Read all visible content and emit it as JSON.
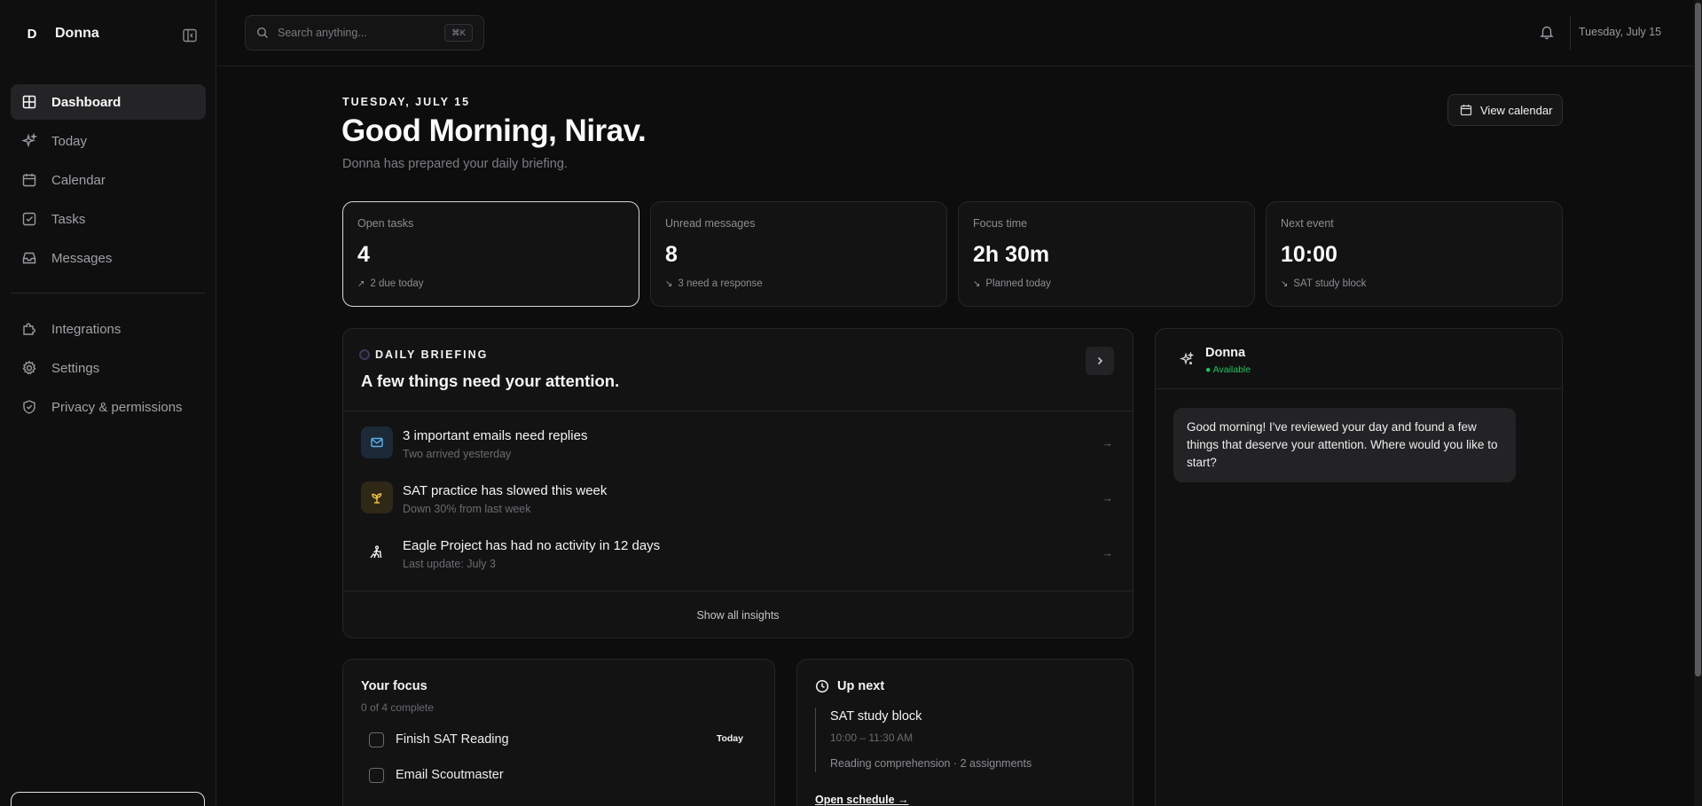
{
  "sidebar": {
    "logo_letter": "D",
    "brand_name": "Donna",
    "items": [
      {
        "label": "Dashboard",
        "icon": "grid-icon"
      },
      {
        "label": "Today",
        "icon": "sparkle-icon"
      },
      {
        "label": "Calendar",
        "icon": "calendar-icon"
      },
      {
        "label": "Tasks",
        "icon": "check-square-icon"
      },
      {
        "label": "Messages",
        "icon": "inbox-icon"
      },
      {
        "label": "Integrations",
        "icon": "puzzle-icon"
      },
      {
        "label": "Settings",
        "icon": "gear-icon"
      },
      {
        "label": "Privacy & permissions",
        "icon": "shield-icon"
      }
    ],
    "active_item": "Dashboard"
  },
  "topbar": {
    "search_placeholder": "Search anything...",
    "shortcut": "⌘K",
    "date": "Tuesday, July 15"
  },
  "header": {
    "date_kicker": "TUESDAY, JULY 15",
    "title": "Good Morning, Nirav.",
    "subtitle": "Donna has prepared your daily briefing.",
    "view_calendar_label": "View calendar"
  },
  "stats": [
    {
      "label": "Open tasks",
      "value": "4",
      "note": "2 due today",
      "arrow": "↗"
    },
    {
      "label": "Unread messages",
      "value": "8",
      "note": "3 need a response",
      "arrow": "↘"
    },
    {
      "label": "Focus time",
      "value": "2h 30m",
      "note": "Planned today",
      "arrow": "↘"
    },
    {
      "label": "Next event",
      "value": "10:00",
      "note": "SAT study block",
      "arrow": "↘"
    }
  ],
  "briefing": {
    "kicker": "DAILY BRIEFING",
    "title": "A few things need your attention.",
    "insights": [
      {
        "title": "3 important emails need replies",
        "subtitle": "Two arrived yesterday",
        "icon": "mail-icon",
        "color": "#5eb0ef"
      },
      {
        "title": "SAT practice has slowed this week",
        "subtitle": "Down 30% from last week",
        "icon": "sprout-icon",
        "color": "#f5c542"
      },
      {
        "title": "Eagle Project has had no activity in 12 days",
        "subtitle": "Last update: July 3",
        "icon": "hiker-icon",
        "color": "#f4f4f5"
      }
    ],
    "footer_label": "Show all insights"
  },
  "focus": {
    "title": "Your focus",
    "subtitle": "0 of 4 complete",
    "tasks": [
      {
        "label": "Finish SAT Reading",
        "tag": "Today"
      },
      {
        "label": "Email Scoutmaster",
        "tag": ""
      }
    ]
  },
  "up_next": {
    "title": "Up next",
    "event_title": "SAT study block",
    "event_time": "10:00 – 11:30 AM",
    "event_desc": "Reading comprehension · 2 assignments",
    "link_label": "Open schedule →"
  },
  "chat": {
    "name": "Donna",
    "status": "● Available",
    "message": "Good morning! I've reviewed your day and found a few things that deserve your attention. Where would you like to start?"
  },
  "colors": {
    "background": "#0d0d0e",
    "surface": "#131314",
    "active_nav": "#242426",
    "status_green": "#22c55e",
    "mail_accent": "#5eb0ef",
    "sat_accent": "#f5c542"
  }
}
